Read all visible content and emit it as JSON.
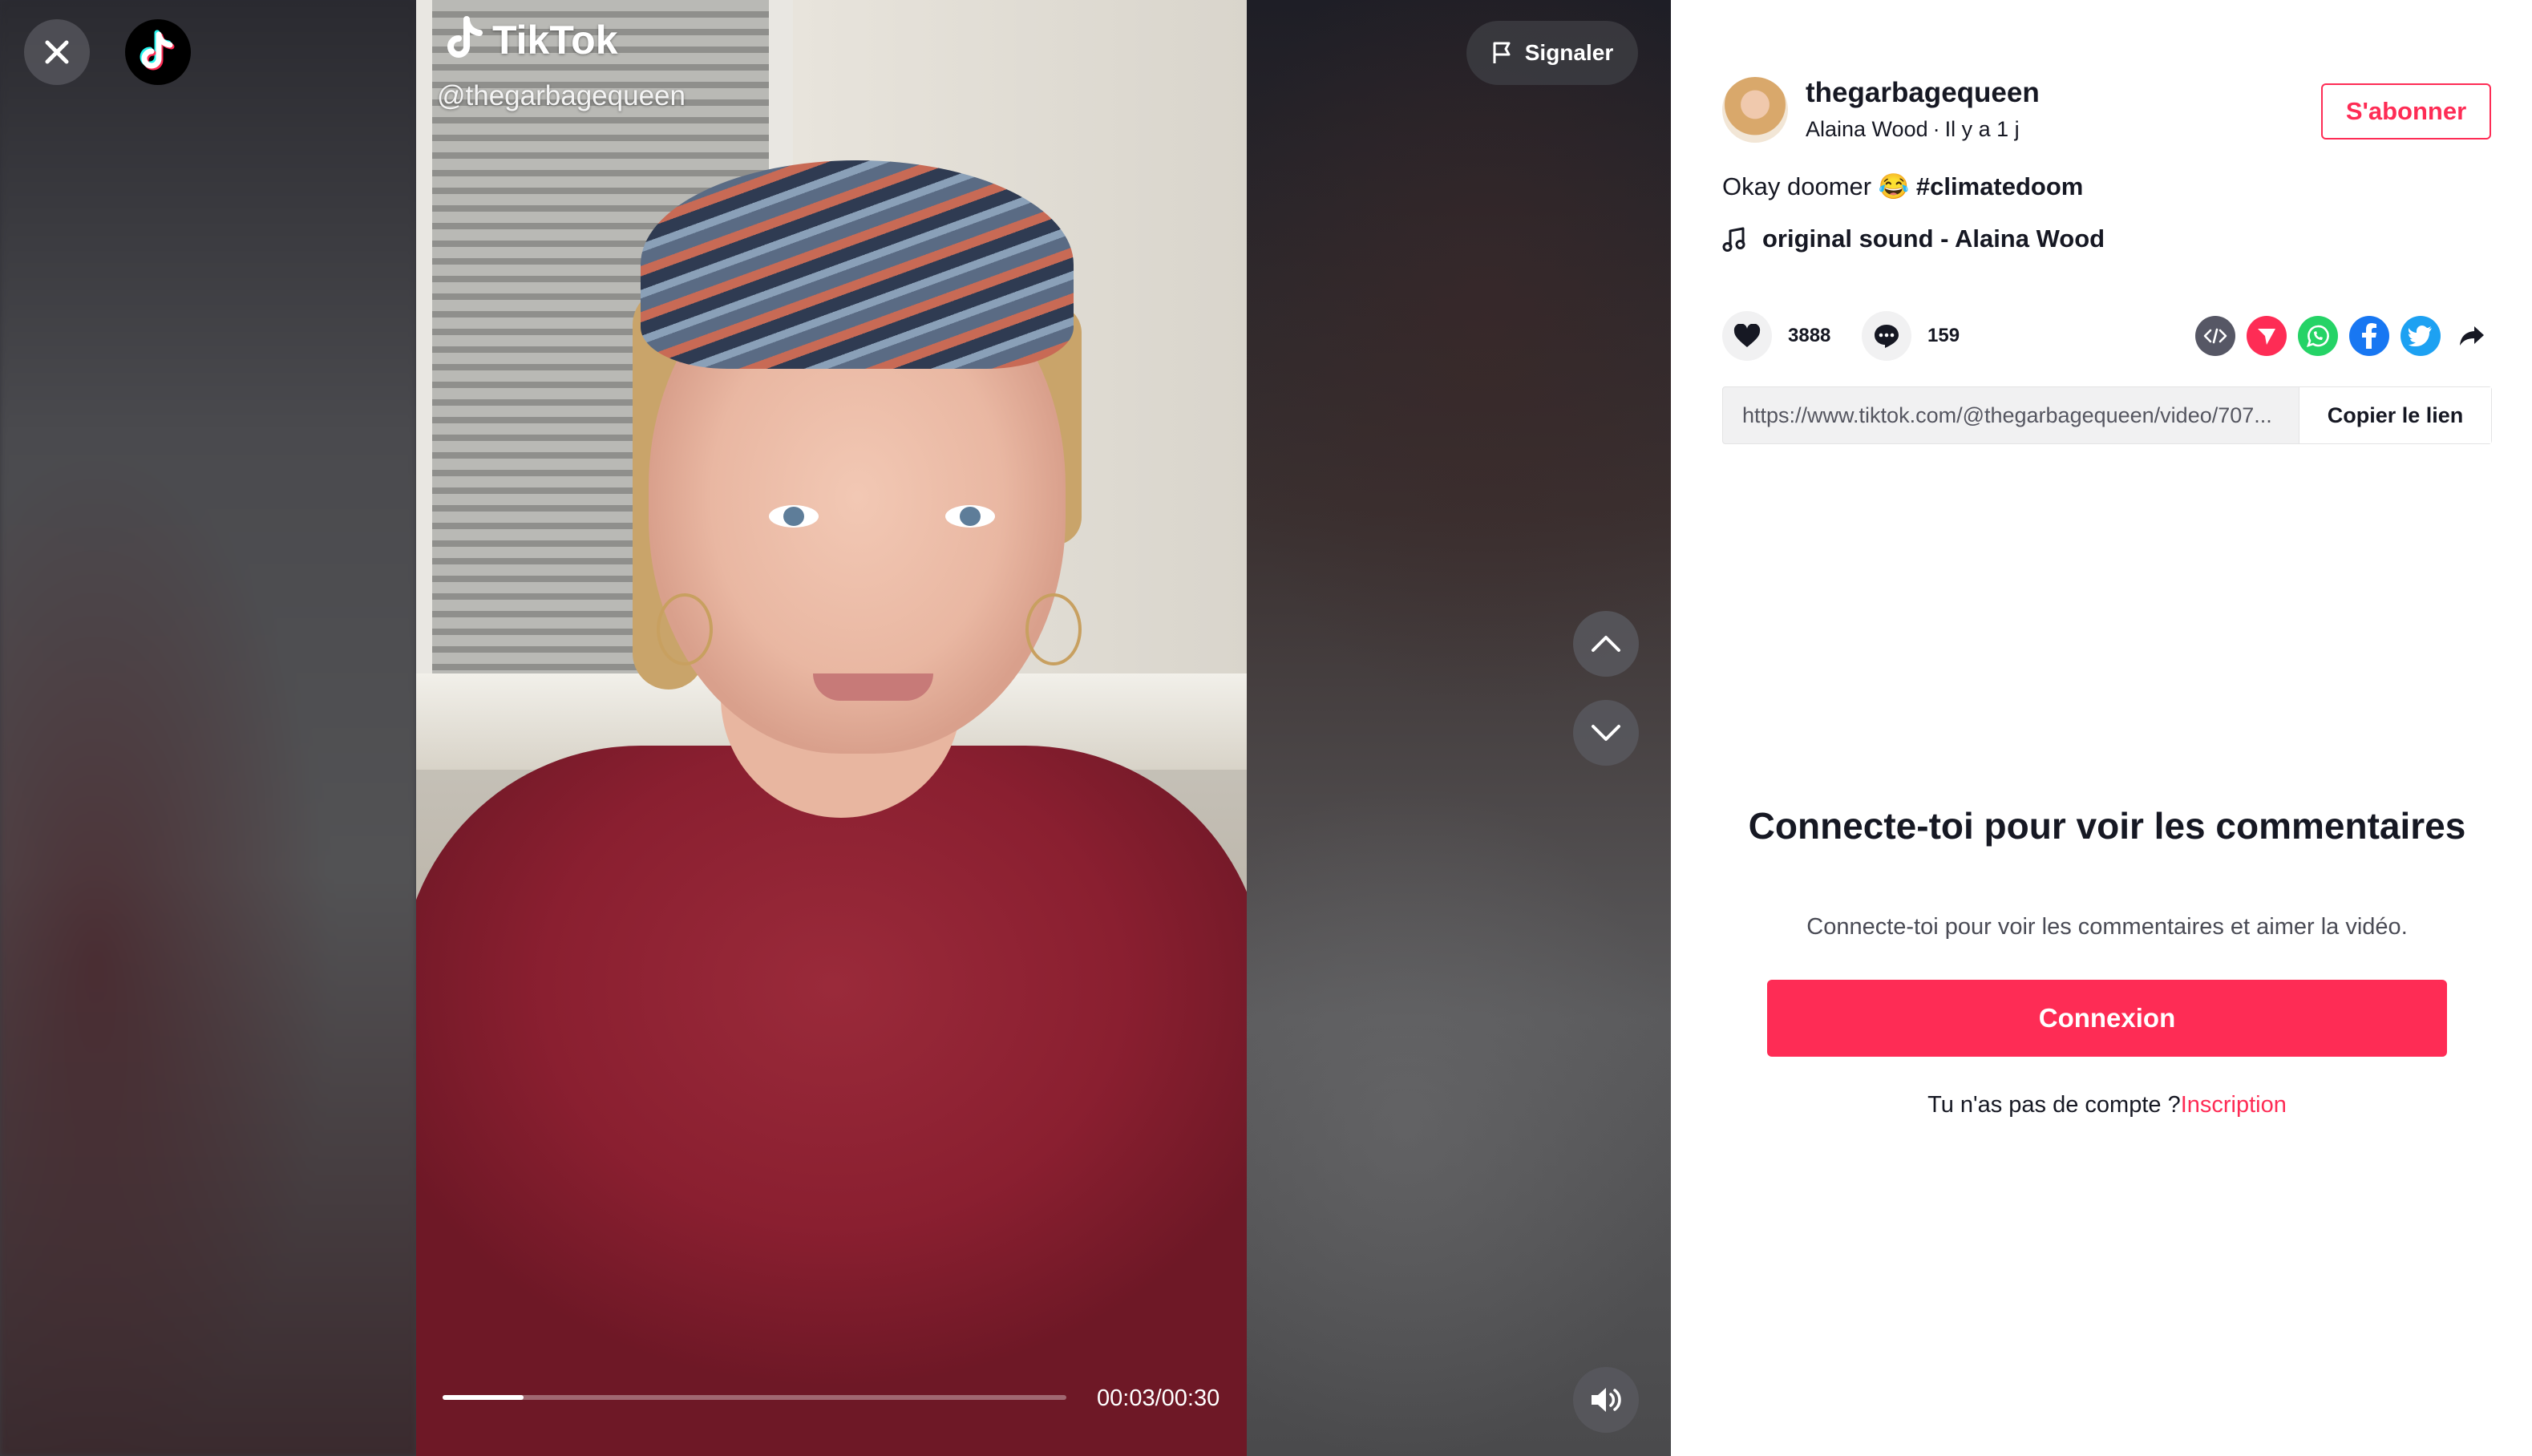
{
  "player": {
    "brand_name": "TikTok",
    "watermark_handle": "@thegarbagequeen",
    "report_label": "Signaler",
    "time_display": "00:03/00:30",
    "progress_fraction": 0.13
  },
  "author": {
    "username": "thegarbagequeen",
    "display_name": "Alaina Wood",
    "separator": "·",
    "posted": "Il y a 1 j",
    "follow_label": "S'abonner"
  },
  "post": {
    "caption_text": "Okay doomer 😂",
    "hashtag": "#climatedoom",
    "sound_title": "original sound - Alaina Wood",
    "likes": "3888",
    "comments": "159",
    "link_url": "https://www.tiktok.com/@thegarbagequeen/video/707...",
    "copy_link_label": "Copier le lien"
  },
  "share_icons": [
    "embed-icon",
    "paper-plane-icon",
    "whatsapp-icon",
    "facebook-icon",
    "twitter-icon",
    "share-arrow-icon"
  ],
  "colors": {
    "brand_red": "#fe2c55",
    "text_dark": "#161823",
    "whatsapp": "#25d366",
    "facebook": "#1877f2",
    "twitter": "#1da1f2",
    "embed": "#565765"
  },
  "login_prompt": {
    "title": "Connecte-toi pour voir les commentaires",
    "subtitle": "Connecte-toi pour voir les commentaires et aimer la vidéo.",
    "button_label": "Connexion",
    "no_account_text": "Tu n'as pas de compte ?",
    "signup_label": "Inscription"
  }
}
